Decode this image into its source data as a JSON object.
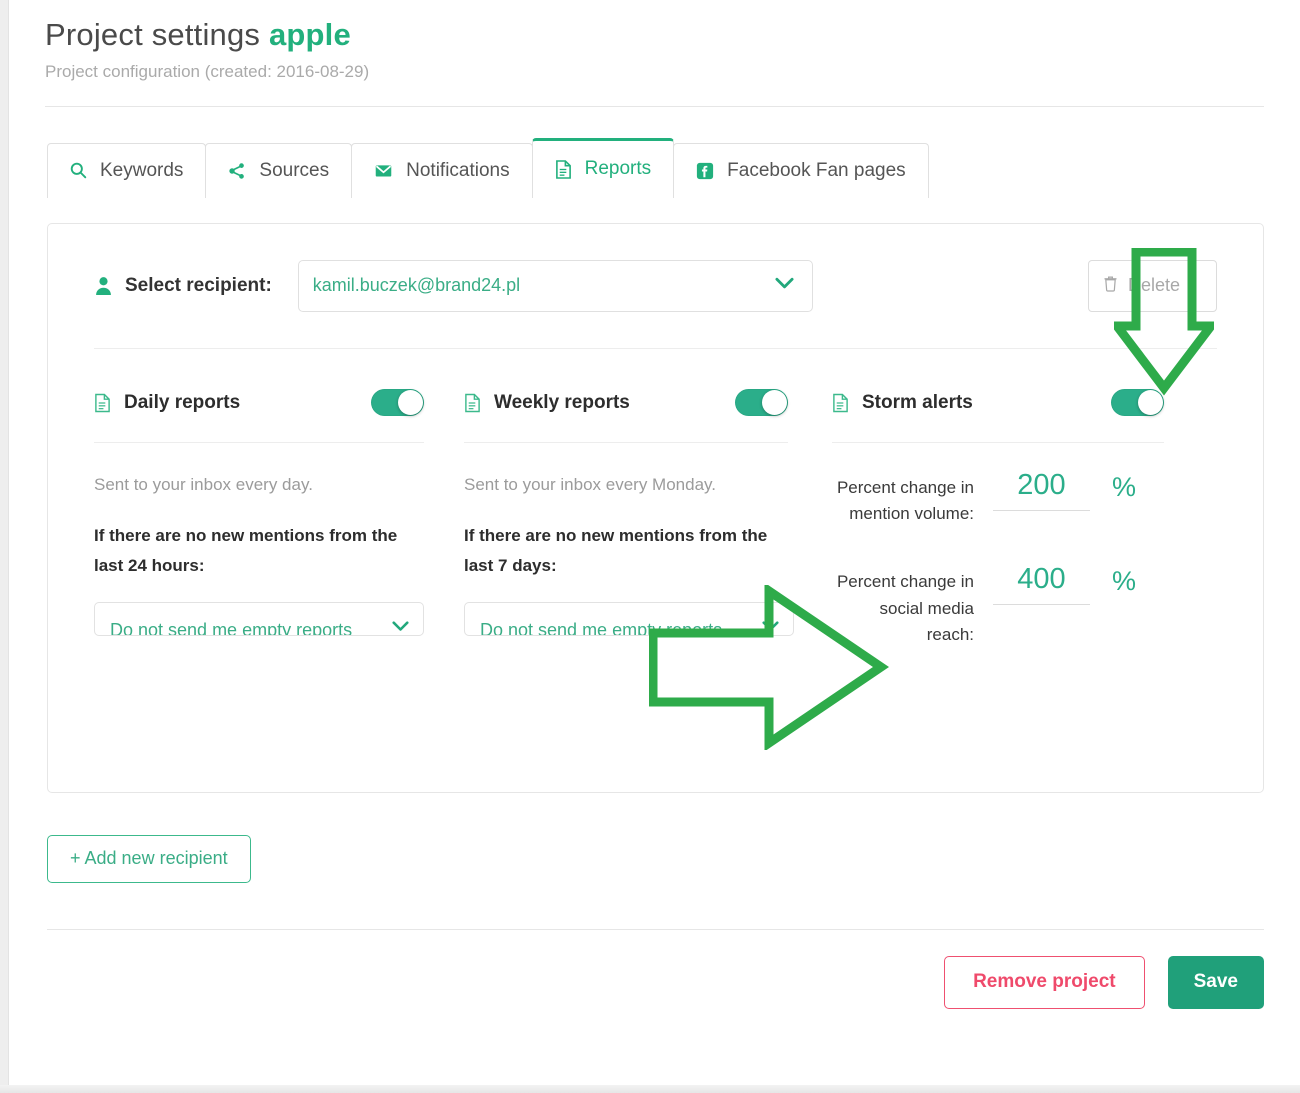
{
  "header": {
    "title_prefix": "Project settings",
    "project_name": "apple",
    "subtitle": "Project configuration (created: 2016-08-29)"
  },
  "tabs": [
    {
      "label": "Keywords",
      "icon": "search-icon",
      "active": false
    },
    {
      "label": "Sources",
      "icon": "share-icon",
      "active": false
    },
    {
      "label": "Notifications",
      "icon": "envelope-icon",
      "active": false
    },
    {
      "label": "Reports",
      "icon": "document-icon",
      "active": true
    },
    {
      "label": "Facebook Fan pages",
      "icon": "facebook-icon",
      "active": false
    }
  ],
  "recipient": {
    "label": "Select recipient:",
    "selected": "kamil.buczek@brand24.pl",
    "delete_label": "Delete"
  },
  "columns": [
    {
      "title": "Daily reports",
      "toggle_on": true,
      "note": "Sent to your inbox every day.",
      "condition": "If there are no new mentions from the last 24 hours:",
      "select_value": "Do not send me empty reports"
    },
    {
      "title": "Weekly reports",
      "toggle_on": true,
      "note": "Sent to your inbox every Monday.",
      "condition": "If there are no new mentions from the last 7 days:",
      "select_value": "Do not send me empty reports"
    },
    {
      "title": "Storm alerts",
      "toggle_on": true
    }
  ],
  "storm": {
    "fields": [
      {
        "label": "Percent change in mention volume:",
        "value": "200",
        "unit": "%"
      },
      {
        "label": "Percent change in social media reach:",
        "value": "400",
        "unit": "%"
      }
    ]
  },
  "footer": {
    "add_recipient": "+ Add new recipient",
    "remove_project": "Remove project",
    "save": "Save"
  },
  "colors": {
    "accent_green": "#22b07d",
    "toggle_green": "#2bae8a",
    "annotation_green": "#2eab4a",
    "danger_red": "#ef4a6b",
    "save_green": "#20a07a",
    "muted_text": "#9b9b9b"
  }
}
